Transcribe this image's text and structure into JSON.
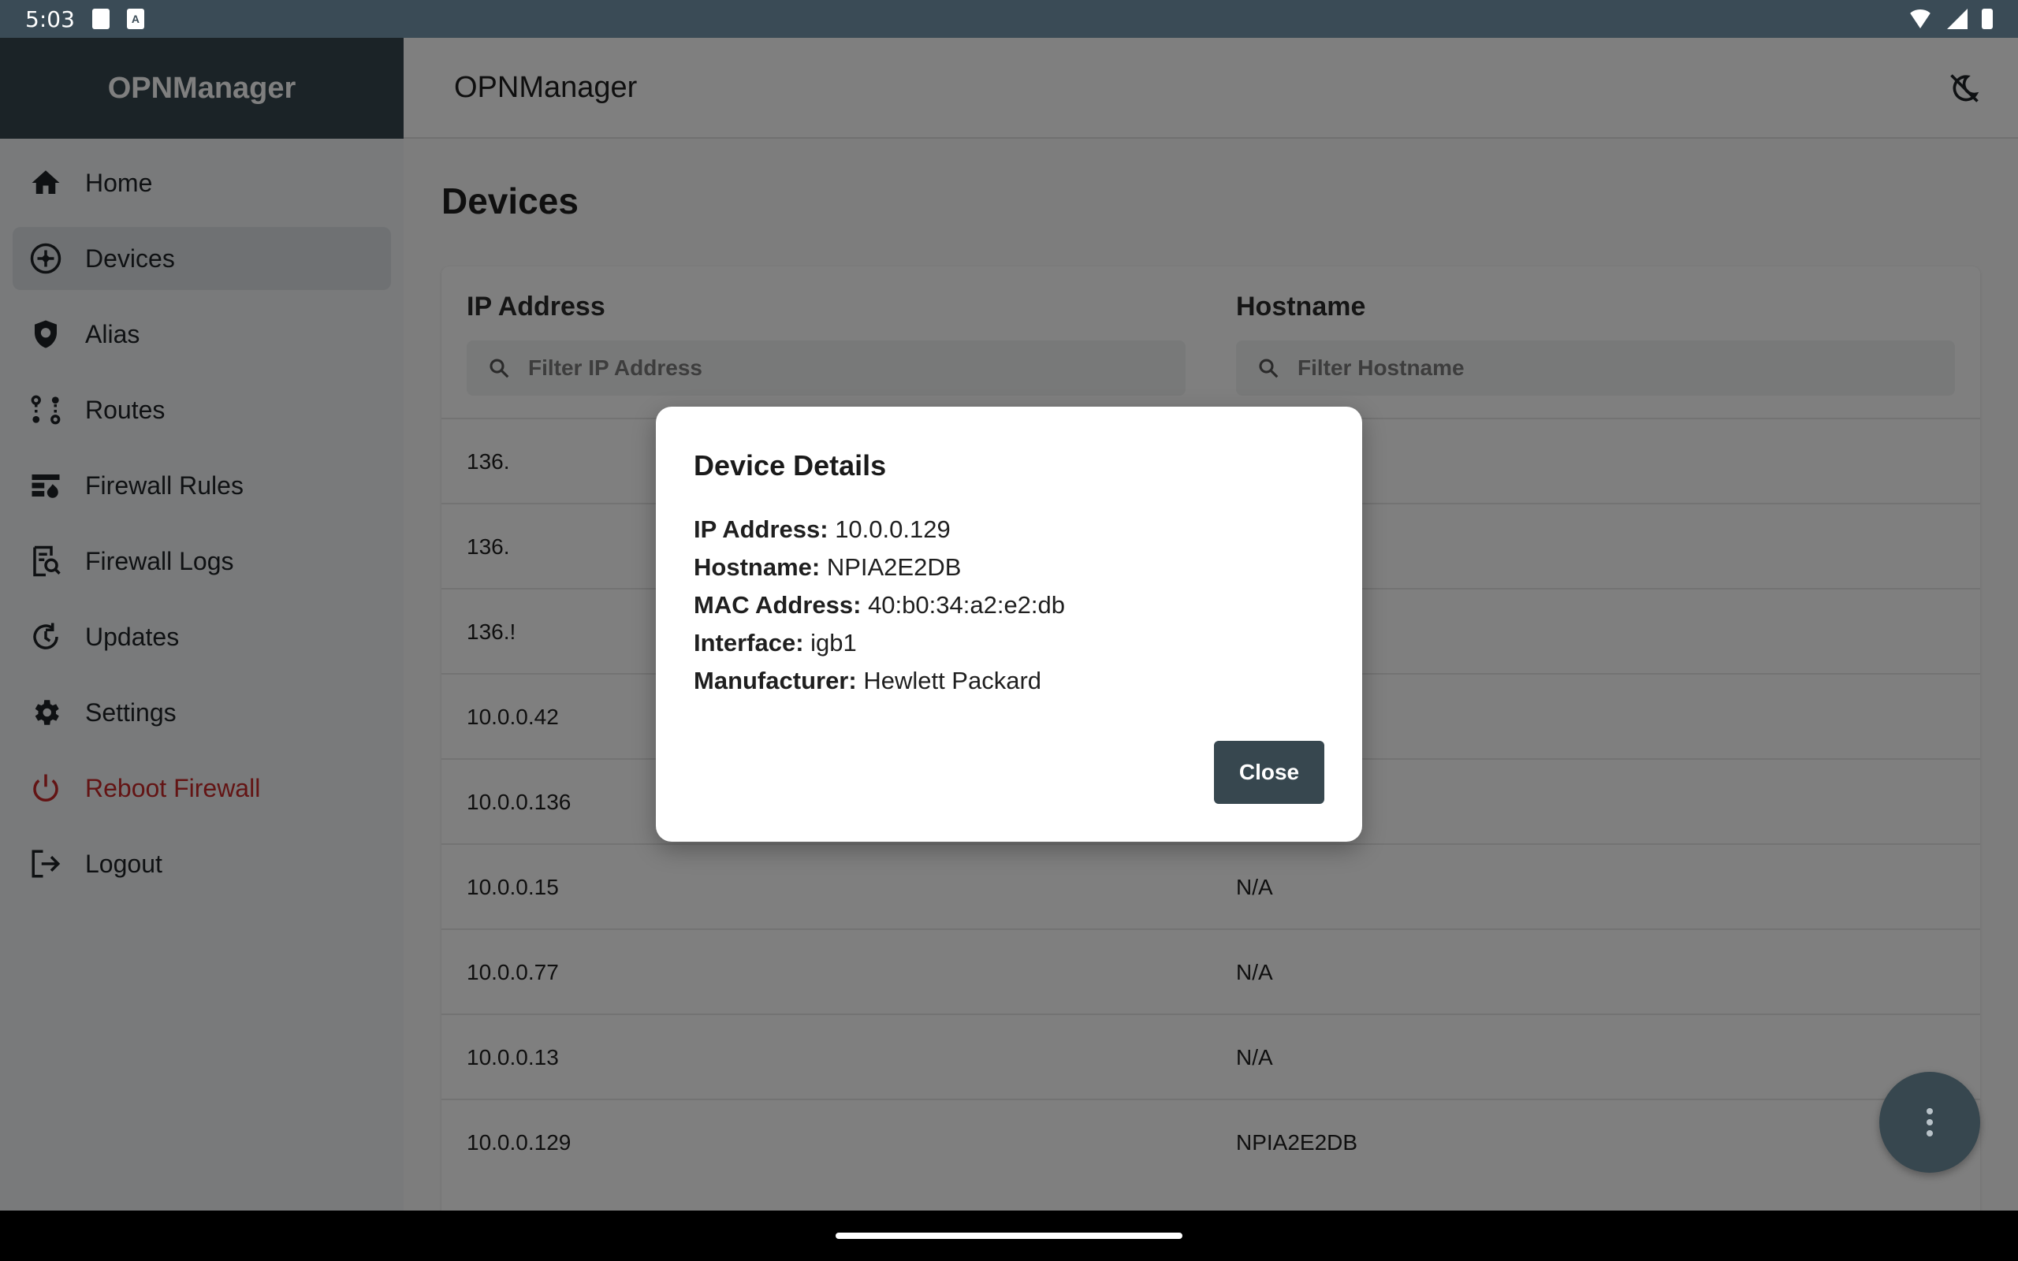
{
  "status_bar": {
    "time": "5:03",
    "icons": [
      "sd-card-icon",
      "a-badge-icon",
      "wifi-icon",
      "signal-icon",
      "battery-icon"
    ]
  },
  "sidebar": {
    "brand": "OPNManager",
    "items": [
      {
        "label": "Home",
        "icon": "home-icon",
        "active": false
      },
      {
        "label": "Devices",
        "icon": "devices-icon",
        "active": true
      },
      {
        "label": "Alias",
        "icon": "shield-icon",
        "active": false
      },
      {
        "label": "Routes",
        "icon": "routes-icon",
        "active": false
      },
      {
        "label": "Firewall Rules",
        "icon": "firewall-rules-icon",
        "active": false
      },
      {
        "label": "Firewall Logs",
        "icon": "firewall-logs-icon",
        "active": false
      },
      {
        "label": "Updates",
        "icon": "updates-icon",
        "active": false
      },
      {
        "label": "Settings",
        "icon": "gear-icon",
        "active": false
      },
      {
        "label": "Reboot Firewall",
        "icon": "power-icon",
        "active": false
      },
      {
        "label": "Logout",
        "icon": "logout-icon",
        "active": false
      }
    ]
  },
  "appbar": {
    "title": "OPNManager",
    "theme_icon": "theme-toggle-icon"
  },
  "main": {
    "page_title": "Devices",
    "table": {
      "columns": [
        {
          "label": "IP Address",
          "filter_placeholder": "Filter IP Address"
        },
        {
          "label": "Hostname",
          "filter_placeholder": "Filter Hostname"
        }
      ],
      "rows": [
        {
          "ip": "136.",
          "hostname": ""
        },
        {
          "ip": "136.",
          "hostname": ""
        },
        {
          "ip": "136.!",
          "hostname": ""
        },
        {
          "ip": "10.0.0.42",
          "hostname": ""
        },
        {
          "ip": "10.0.0.136",
          "hostname": ""
        },
        {
          "ip": "10.0.0.15",
          "hostname": "N/A"
        },
        {
          "ip": "10.0.0.77",
          "hostname": "N/A"
        },
        {
          "ip": "10.0.0.13",
          "hostname": "N/A"
        },
        {
          "ip": "10.0.0.129",
          "hostname": "NPIA2E2DB"
        }
      ]
    }
  },
  "dialog": {
    "title": "Device Details",
    "fields": [
      {
        "label": "IP Address:",
        "value": "10.0.0.129"
      },
      {
        "label": "Hostname:",
        "value": "NPIA2E2DB"
      },
      {
        "label": "MAC Address:",
        "value": "40:b0:34:a2:e2:db"
      },
      {
        "label": "Interface:",
        "value": "igb1"
      },
      {
        "label": "Manufacturer:",
        "value": "Hewlett Packard"
      }
    ],
    "close_label": "Close"
  },
  "fab": {
    "icon": "more-vert-icon"
  },
  "colors": {
    "primary": "#37474f",
    "danger": "#c62828",
    "status_bar": "#3a4b56"
  }
}
